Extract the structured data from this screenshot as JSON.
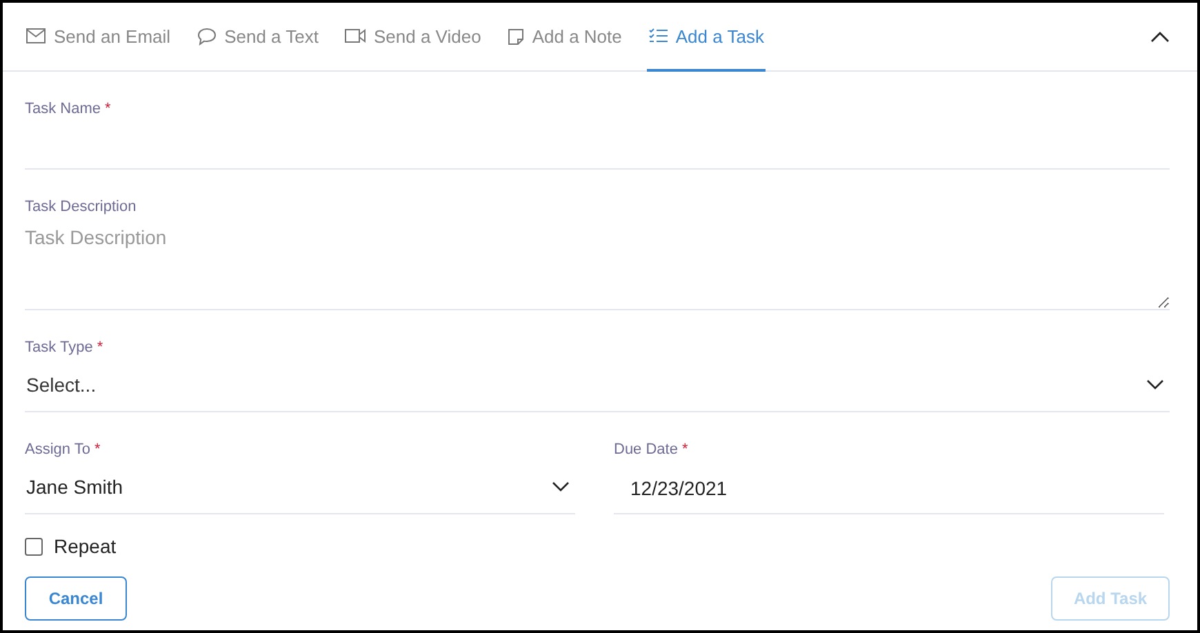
{
  "tabs": [
    {
      "label": "Send an Email",
      "kind": "email",
      "selected": false
    },
    {
      "label": "Send a Text",
      "kind": "chat",
      "selected": false
    },
    {
      "label": "Send a Video",
      "kind": "video",
      "selected": false
    },
    {
      "label": "Add a Note",
      "kind": "note",
      "selected": false
    },
    {
      "label": "Add a Task",
      "kind": "tasks",
      "selected": true
    }
  ],
  "rows": [
    [
      {
        "kind": "text",
        "label": "Task Name",
        "required_mark": "*"
      }
    ],
    [
      {
        "kind": "textarea",
        "label": "Task Description",
        "placeholder": "Task Description"
      }
    ],
    [
      {
        "kind": "select",
        "label": "Task Type",
        "required_mark": "*",
        "value": "Select..."
      }
    ],
    [
      {
        "kind": "select",
        "label": "Assign To",
        "required_mark": "*",
        "value": "Jane Smith"
      },
      {
        "kind": "date",
        "label": "Due Date",
        "required_mark": "*",
        "value": "12/23/2021"
      }
    ]
  ],
  "repeat": {
    "label": "Repeat",
    "checked": false
  },
  "buttons": [
    {
      "label": "Cancel",
      "disabled": false
    },
    {
      "label": "Add Task",
      "disabled": true
    }
  ]
}
